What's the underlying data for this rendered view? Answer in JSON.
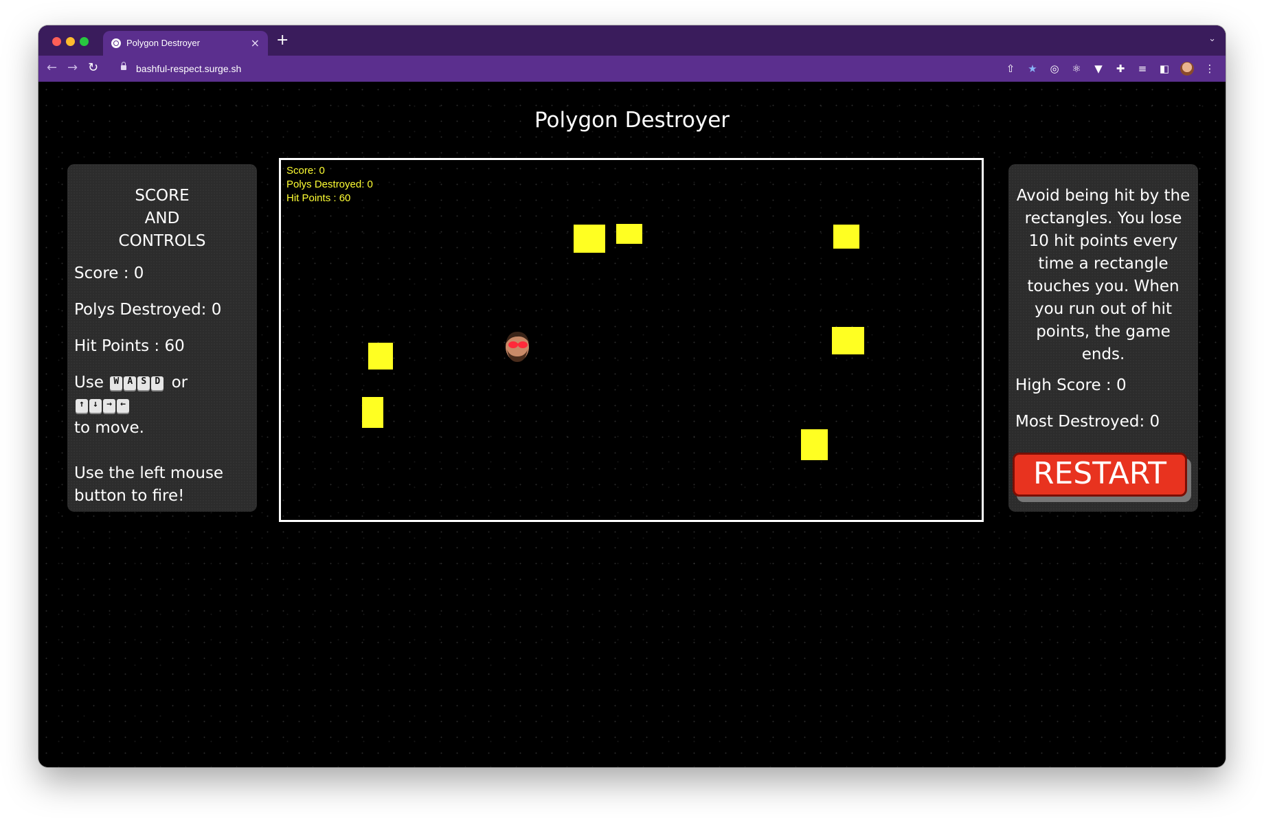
{
  "browser": {
    "tab_title": "Polygon Destroyer",
    "tab_close": "×",
    "new_tab": "+",
    "tab_menu": "⌄",
    "url": "bashful-respect.surge.sh"
  },
  "page": {
    "title": "Polygon Destroyer"
  },
  "left_panel": {
    "heading_line1": "SCORE",
    "heading_line2": "AND",
    "heading_line3": "CONTROLS",
    "score": "Score : 0",
    "polys_destroyed": "Polys Destroyed: 0",
    "hit_points": "Hit Points : 60",
    "move_use": "Use",
    "move_keys_wasd": [
      "W",
      "A",
      "S",
      "D"
    ],
    "move_or": "or",
    "move_keys_arrows": [
      "↑",
      "↓",
      "→",
      "←"
    ],
    "move_suffix": "to move.",
    "fire_instructions": "Use the left mouse button to fire!"
  },
  "right_panel": {
    "rules": "Avoid being hit by the rectangles. You lose 10 hit points every time a rectangle touches you. When you run out of hit points, the game ends.",
    "high_score": "High Score : 0",
    "most_destroyed": "Most Destroyed: 0",
    "restart_label": "RESTART"
  },
  "game": {
    "hud_score": "Score: 0",
    "hud_polys": "Polys Destroyed: 0",
    "hud_hp": "Hit Points : 60"
  },
  "colors": {
    "tab_strip": "#3a1c5c",
    "toolbar": "#5b2f8e",
    "poly": "#ffff22",
    "hud_text": "#ffff33",
    "restart": "#e8331f"
  }
}
